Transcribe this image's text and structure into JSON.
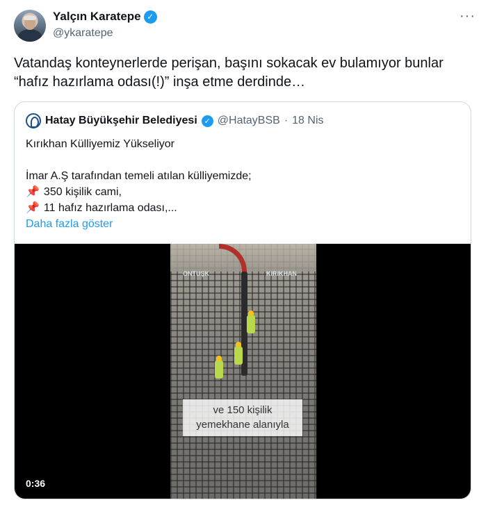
{
  "author": {
    "name": "Yalçın Karatepe",
    "handle": "@ykaratepe"
  },
  "more_label": "···",
  "tweet": {
    "lines": [
      "Vatandaş konteynerlerde perişan, başını sokacak ev bulamıyor bunlar",
      "“hafız hazırlama odası(!)” inşa etme derdinde…"
    ]
  },
  "quote": {
    "name": "Hatay Büyükşehir Belediyesi",
    "handle": "@HatayBSB",
    "separator": "·",
    "date": "18 Nis",
    "lines": [
      "Kırıkhan Külliyemiz Yükseliyor",
      "İmar A.Ş tarafından temeli atılan külliyemizde;",
      "350 kişilik cami,",
      "11 hafız hazırlama odası,..."
    ],
    "pin_icon": "📌",
    "show_more": "Daha fazla göster"
  },
  "video": {
    "caption_lines": [
      "ve 150 kişilik",
      "yemekhane alanıyla"
    ],
    "duration": "0:36",
    "watermark_left": "ONTUŞK",
    "watermark_right": "KIRIKHAN"
  },
  "colors": {
    "verified": "#1d9bf0",
    "link": "#1d9bf0",
    "secondary_text": "#536471",
    "border": "#cfd9de"
  }
}
